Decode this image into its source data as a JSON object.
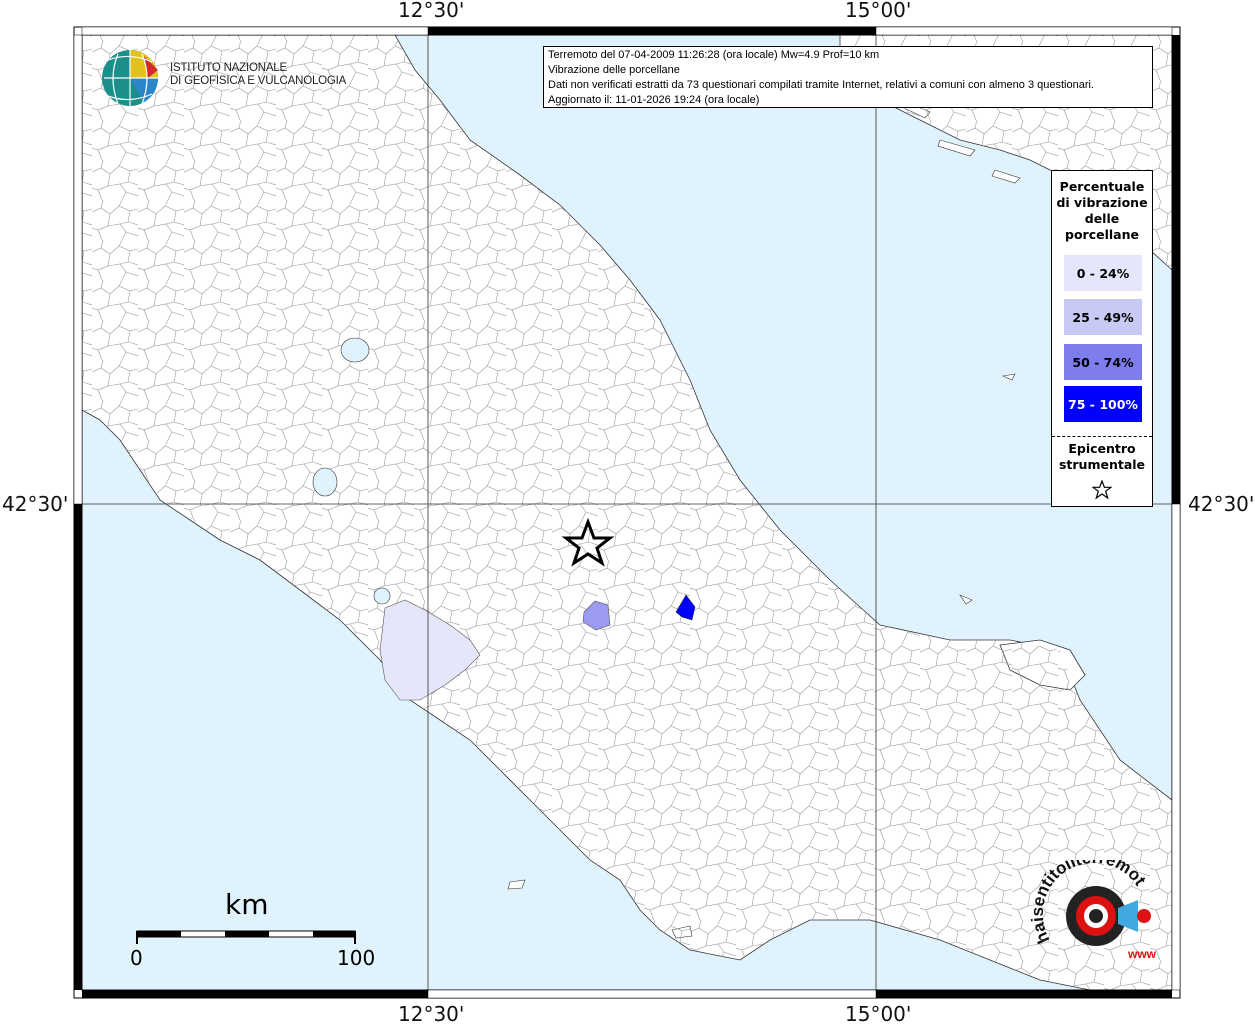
{
  "map": {
    "graticule": {
      "top_left_lon": "12°30'",
      "top_right_lon": "15°00'",
      "bottom_left_lon": "12°30'",
      "bottom_right_lon": "15°00'",
      "left_lat": "42°30'",
      "right_lat": "42°30'"
    },
    "colors": {
      "sea": "#e0f2fc",
      "land": "#ffffff",
      "level_0_24": "#e6e6fa",
      "level_25_49": "#c9c9f5",
      "level_50_74": "#7d7dee",
      "level_75_100": "#0000ff"
    }
  },
  "info": {
    "line1": "Terremoto del 07-04-2009 11:26:28 (ora locale) Mw=4.9 Prof=10 km",
    "line2": "Vibrazione delle porcellane",
    "line3": "Dati non verificati estratti da 73 questionari compilati tramite Internet, relativi a comuni con almeno 3 questionari.",
    "line4": "Aggiornato il: 11-01-2026 19:24 (ora locale)"
  },
  "legend": {
    "title_line1": "Percentuale",
    "title_line2": "di vibrazione",
    "title_line3": "delle",
    "title_line4": "porcellane",
    "items": [
      {
        "label": "0 - 24%"
      },
      {
        "label": "25 - 49%"
      },
      {
        "label": "50 - 74%"
      },
      {
        "label": "75 - 100%"
      }
    ],
    "epicenter_line1": "Epicentro",
    "epicenter_line2": "strumentale"
  },
  "logo": {
    "line1": "ISTITUTO NAZIONALE",
    "line2": "DI GEOFISICA E VULCANOLOGIA"
  },
  "scale": {
    "unit": "km",
    "min": "0",
    "max": "100"
  },
  "brand": {
    "text": "haisentitoilterremoto.it",
    "sub": "www"
  }
}
